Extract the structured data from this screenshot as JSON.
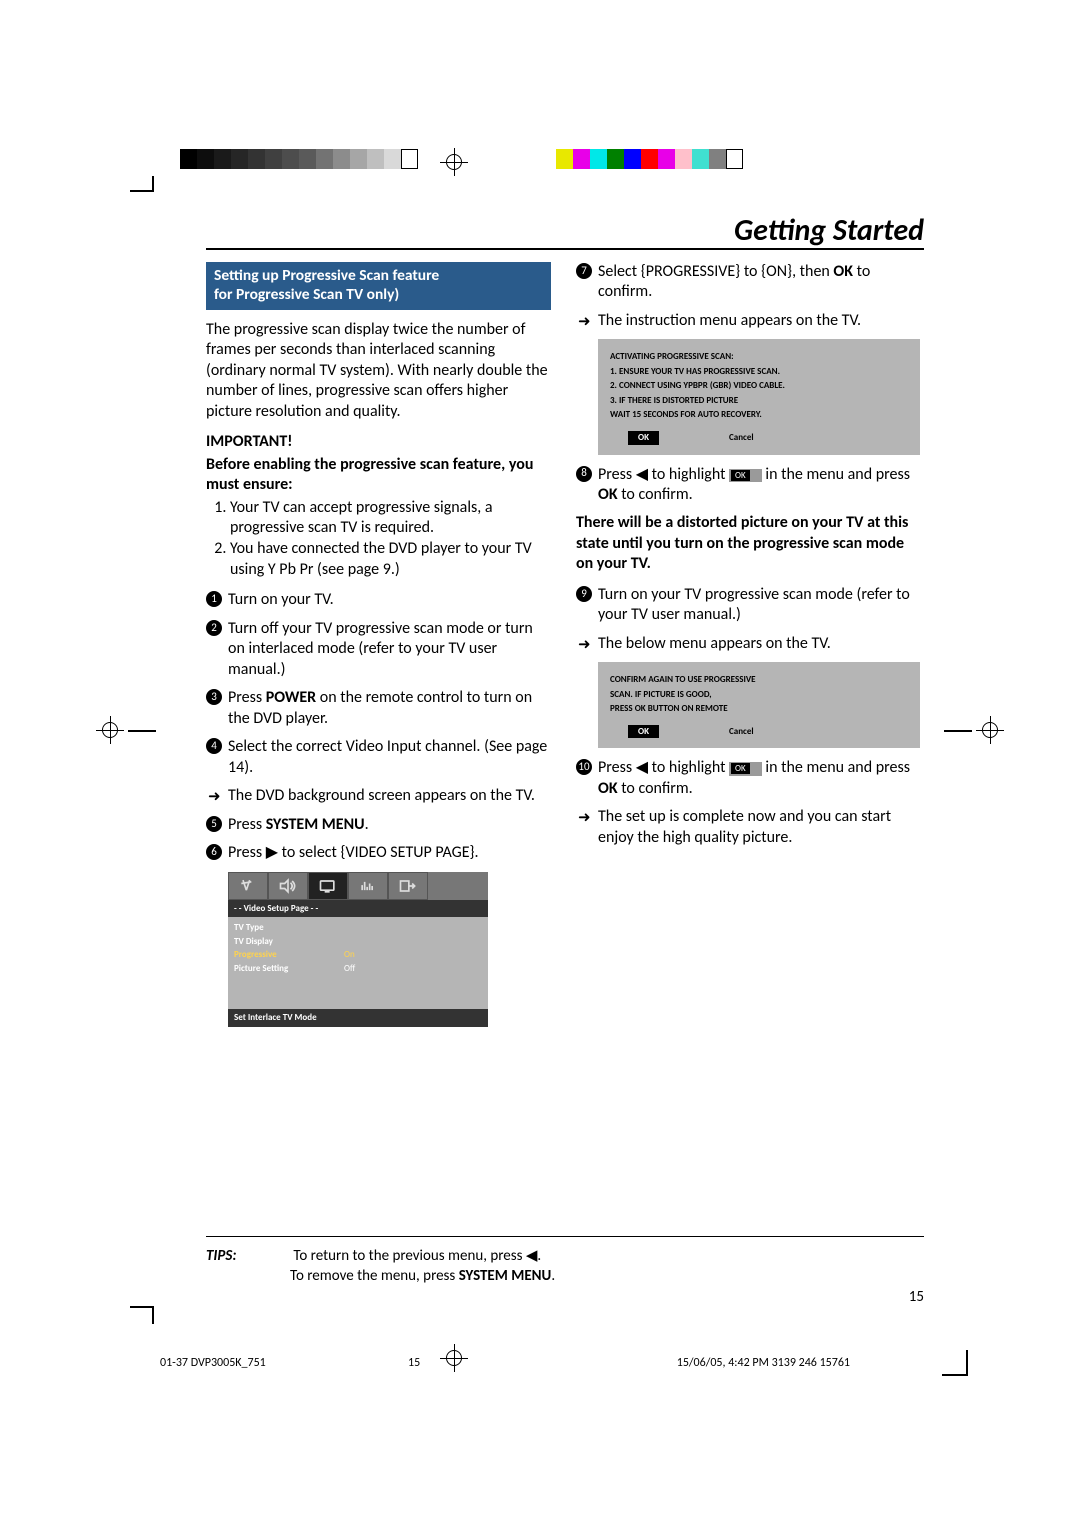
{
  "color_bar_grayscale": [
    "#000000",
    "#0d0d0d",
    "#1a1a1a",
    "#262626",
    "#333333",
    "#404040",
    "#4d4d4d",
    "#5a5a5a",
    "#737373",
    "#8c8c8c",
    "#a6a6a6",
    "#bfbfbf",
    "#d9d9d9",
    "#ffffff"
  ],
  "color_bar_color": [
    "#e8e800",
    "#e800e8",
    "#00e8e8",
    "#008000",
    "#0000ff",
    "#ff0000",
    "#e800e8",
    "#ffc0cb",
    "#40e0d0",
    "#808080",
    "#ffffff"
  ],
  "page_title": "Getting Started",
  "section_heading_line1": "Setting up Progressive Scan feature",
  "section_heading_line2": "for Progressive Scan TV only)",
  "intro_para": "The progressive scan display twice the number of frames per seconds than interlaced scanning (ordinary normal TV system). With nearly double the number of lines, progressive scan offers higher picture resolution and quality.",
  "important_label": "IMPORTANT!",
  "before_line": "Before enabling the progressive scan feature, you must ensure:",
  "check1": "Your TV can accept progressive signals, a progressive scan TV is required.",
  "check2": "You have connected the DVD player to your TV using Y Pb Pr (see page 9.)",
  "step1": "Turn on your TV.",
  "step2": "Turn off your TV progressive scan mode or turn on interlaced mode (refer to your TV user manual.)",
  "step3_a": "Press ",
  "step3_b": "POWER",
  "step3_c": " on the remote control to turn on the DVD player.",
  "step4_a": "Select the correct Video Input channel. (See page 14).",
  "step4_arrow": "The DVD background screen appears on the TV.",
  "step5_a": "Press ",
  "step5_b": "SYSTEM MENU",
  "step5_c": ".",
  "step6_a": "Press ",
  "step6_b": " to select {VIDEO SETUP PAGE}.",
  "tvbox_header": "- -   Video Setup Page   - -",
  "tvbox_rows": {
    "r1": "TV Type",
    "r2": "TV Display",
    "r3k": "Progressive",
    "r3v": "On",
    "r4k": "Picture Setting",
    "r4v": "Off"
  },
  "tvbox_footer": "Set Interlace TV Mode",
  "step7_a": "Select {PROGRESSIVE} to {ON}, then ",
  "step7_b": "OK",
  "step7_c": " to confirm.",
  "step7_arrow": "The instruction menu appears on the TV.",
  "dialog1": {
    "l1": "ACTIVATING PROGRESSIVE SCAN:",
    "l2": "1. ENSURE YOUR TV HAS PROGRESSIVE SCAN.",
    "l3": "2. CONNECT USING YPBPR (GBR) VIDEO CABLE.",
    "l4": "3. IF THERE IS DISTORTED PICTURE",
    "l5": "WAIT 15 SECONDS FOR AUTO RECOVERY.",
    "ok": "OK",
    "cancel": "Cancel"
  },
  "step8_a": "Press ",
  "step8_b": " to highlight ",
  "step8_c": " in the menu and press ",
  "step8_d": "OK",
  "step8_e": " to confirm.",
  "ok_pill": "OK",
  "distorted_para": "There will be a distorted picture on your TV at this state until you turn on the progressive scan mode on your TV.",
  "step9_a": "Turn on your TV progressive scan mode (refer to your TV user manual.)",
  "step9_arrow": "The below menu appears on the TV.",
  "dialog2": {
    "l1": "CONFIRM AGAIN TO USE PROGRESSIVE",
    "l2": "SCAN.  IF PICTURE IS GOOD,",
    "l3": "PRESS OK BUTTON ON REMOTE",
    "ok": "OK",
    "cancel": "Cancel"
  },
  "step10_a": "Press ",
  "step10_b": " to highlight ",
  "step10_c": " in the menu and press ",
  "step10_d": "OK",
  "step10_e": " to confirm.",
  "step10_arrow": "The set up is complete now and you can start enjoy the high quality picture.",
  "tips_label": "TIPS:",
  "tips_line1_a": "To return to the previous menu, press ",
  "tips_line2_a": "To remove the menu, press ",
  "tips_line2_b": "SYSTEM MENU",
  "tips_line2_c": ".",
  "page_number": "15",
  "footer_file": "01-37 DVP3005K_751",
  "footer_page": "15",
  "footer_date": "15/06/05, 4:42 PM",
  "footer_code": "3139 246 15761",
  "glyph_left": "◀",
  "glyph_right": "▶",
  "glyph_arrow": "➜"
}
